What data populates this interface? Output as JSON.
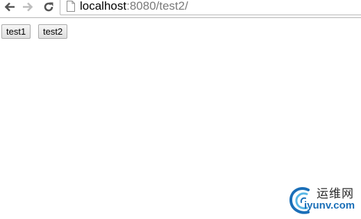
{
  "browser": {
    "back_icon": "arrow-left-icon",
    "forward_icon": "arrow-right-icon",
    "reload_icon": "reload-icon",
    "page_icon": "document-icon",
    "url_host": "localhost",
    "url_rest": ":8080/test2/"
  },
  "page": {
    "buttons": [
      {
        "label": "test1"
      },
      {
        "label": "test2"
      }
    ]
  },
  "watermark": {
    "brand_cn": "运维网",
    "brand_en": "iyunv.com",
    "colors": {
      "swirl_dark": "#1b6fb8",
      "swirl_light": "#5ab7e6"
    }
  }
}
